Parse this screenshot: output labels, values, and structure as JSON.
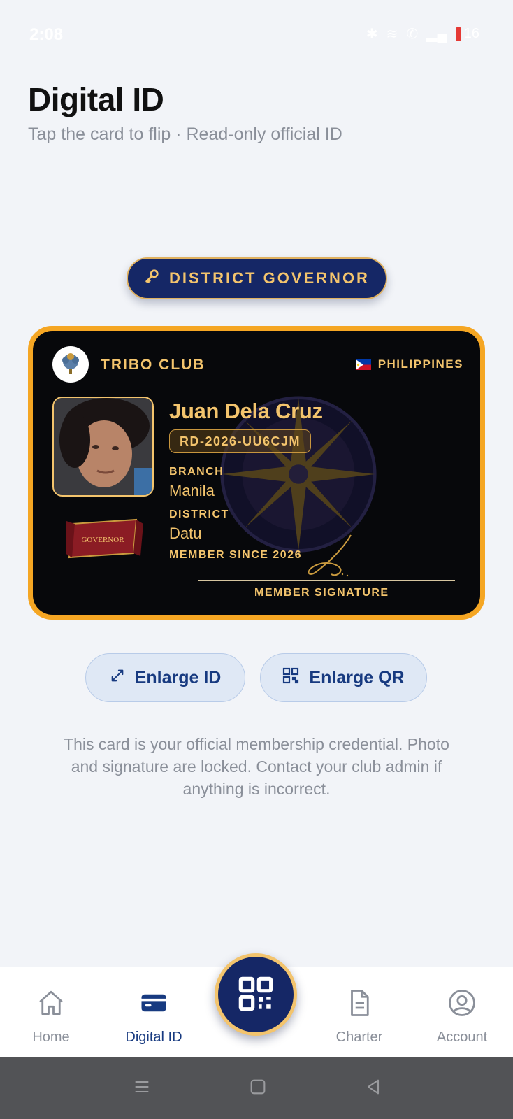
{
  "status_bar": {
    "time": "2:08",
    "battery": "16"
  },
  "header": {
    "title": "Digital ID",
    "subtitle": "Tap the card to flip · Read-only official ID"
  },
  "role_badge": {
    "label": "DISTRICT GOVERNOR",
    "icon": "key-icon"
  },
  "id_card": {
    "club_name": "TRIBO CLUB",
    "country": "PHILIPPINES",
    "member_name": "Juan Dela Cruz",
    "member_code": "RD-2026-UU6CJM",
    "branch_label": "BRANCH",
    "branch_value": "Manila",
    "district_label": "DISTRICT",
    "district_value": "Datu",
    "member_since": "MEMBER SINCE 2026",
    "ribbon_text": "GOVERNOR",
    "signature_label": "MEMBER SIGNATURE"
  },
  "actions": {
    "enlarge_id": "Enlarge ID",
    "enlarge_qr": "Enlarge QR"
  },
  "info_text": "This card is your official membership credential. Photo and signature are locked. Contact your club admin if anything is incorrect.",
  "bottom_nav": {
    "items": [
      {
        "label": "Home",
        "icon": "home-icon",
        "active": false
      },
      {
        "label": "Digital ID",
        "icon": "id-card-icon",
        "active": true
      },
      {
        "label": "Charter",
        "icon": "document-icon",
        "active": false
      },
      {
        "label": "Account",
        "icon": "account-icon",
        "active": false
      }
    ],
    "fab_icon": "qr-code-icon"
  },
  "colors": {
    "navy": "#152766",
    "gold": "#f3c46d",
    "card_border": "#f5a623",
    "background": "#f2f4f8"
  }
}
